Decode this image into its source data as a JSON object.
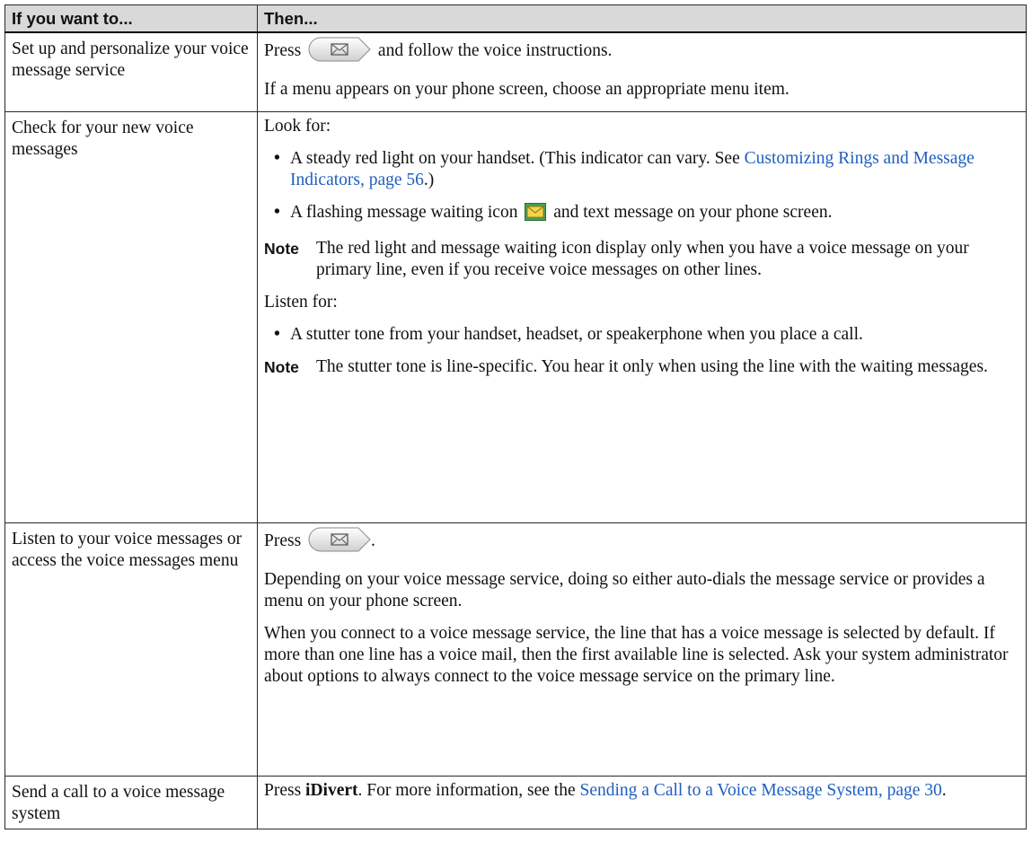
{
  "table": {
    "header": {
      "col1": "If you want to...",
      "col2": "Then..."
    },
    "row1": {
      "task": "Set up and personalize your voice message service",
      "p1_before": "Press",
      "p1_after": "and follow the voice instructions.",
      "p2": "If a menu appears on your phone screen, choose an appropriate menu item."
    },
    "row2": {
      "task": "Check for your new voice messages",
      "look_for": "Look for:",
      "bullet1_text": "A steady red light on your handset. (This indicator can vary. See",
      "bullet1_link": "Customizing Rings and Message Indicators, page 56",
      "bullet1_end": ".)",
      "bullet2_before": "A flashing message waiting icon",
      "bullet2_after": "and text message on your phone screen.",
      "note1_label": "Note",
      "note1_text": "The red light and message waiting icon display only when you have a voice message on your primary line, even if you receive voice messages on other lines.",
      "listen_for": "Listen for:",
      "bullet3": "A stutter tone from your handset, headset, or speakerphone when you place a call.",
      "note2_label": "Note",
      "note2_text": "The stutter tone is line-specific. You hear it only when using the line with the waiting messages."
    },
    "row3": {
      "task": "Listen to your voice messages or access the voice messages menu",
      "p1_before": "Press",
      "p1_after": ".",
      "p2": "Depending on your voice message service, doing so either auto-dials the message service or provides a menu on your phone screen.",
      "p3": "When you connect to a voice message service, the line that has a voice message is selected by default. If more than one line has a voice mail, then the first available line is selected. Ask your system administrator about options to always connect to the voice message service on the primary line."
    },
    "row4": {
      "task": "Send a call to a voice message system",
      "press": "Press",
      "softkey": "iDivert",
      "mid": ". For more information, see the",
      "link": "Sending a Call to a Voice Message System, page 30",
      "end": "."
    }
  },
  "icons": {
    "messages_button": "envelope-messages-button-icon",
    "message_waiting": "message-waiting-envelope-icon"
  },
  "colors": {
    "link": "#1f5fbf",
    "header_bg": "#d9d9d9",
    "icon_yellow": "#f2d44a",
    "icon_bg": "#4aa055"
  }
}
